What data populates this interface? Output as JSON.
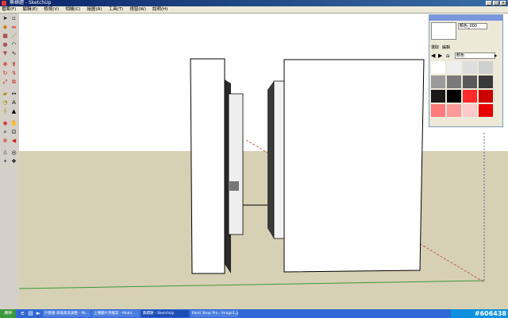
{
  "window": {
    "title": "無標題 - SketchUp"
  },
  "menu": [
    "檔案(F)",
    "編輯(E)",
    "檢視(V)",
    "相機(C)",
    "繪圖(R)",
    "工具(T)",
    "視窗(W)",
    "說明(H)"
  ],
  "material_panel": {
    "name": "顏色_000",
    "tabs": [
      "選取",
      "編輯"
    ],
    "category": "顏色",
    "swatches": [
      "#ffffff",
      "#eeeeee",
      "#dddddd",
      "#cfcfcf",
      "#9a9a9a",
      "#7a7a7a",
      "#5a5a5a",
      "#3a3a3a",
      "#1a1a1a",
      "#000000",
      "#ff2a2a",
      "#cc0000",
      "#ff7a7a",
      "#ff9a9a",
      "#ffc8c8",
      "#e60000"
    ]
  },
  "taskbar": {
    "start": "開始",
    "tasks": [
      "計劃書-家裝家具調整 - Mi...",
      "上傳圖片到檔案 - Mobil...",
      "無標題 - SketchUp",
      "Paint Shop Pro - Image1.jpg"
    ],
    "watermark": "#606438"
  }
}
